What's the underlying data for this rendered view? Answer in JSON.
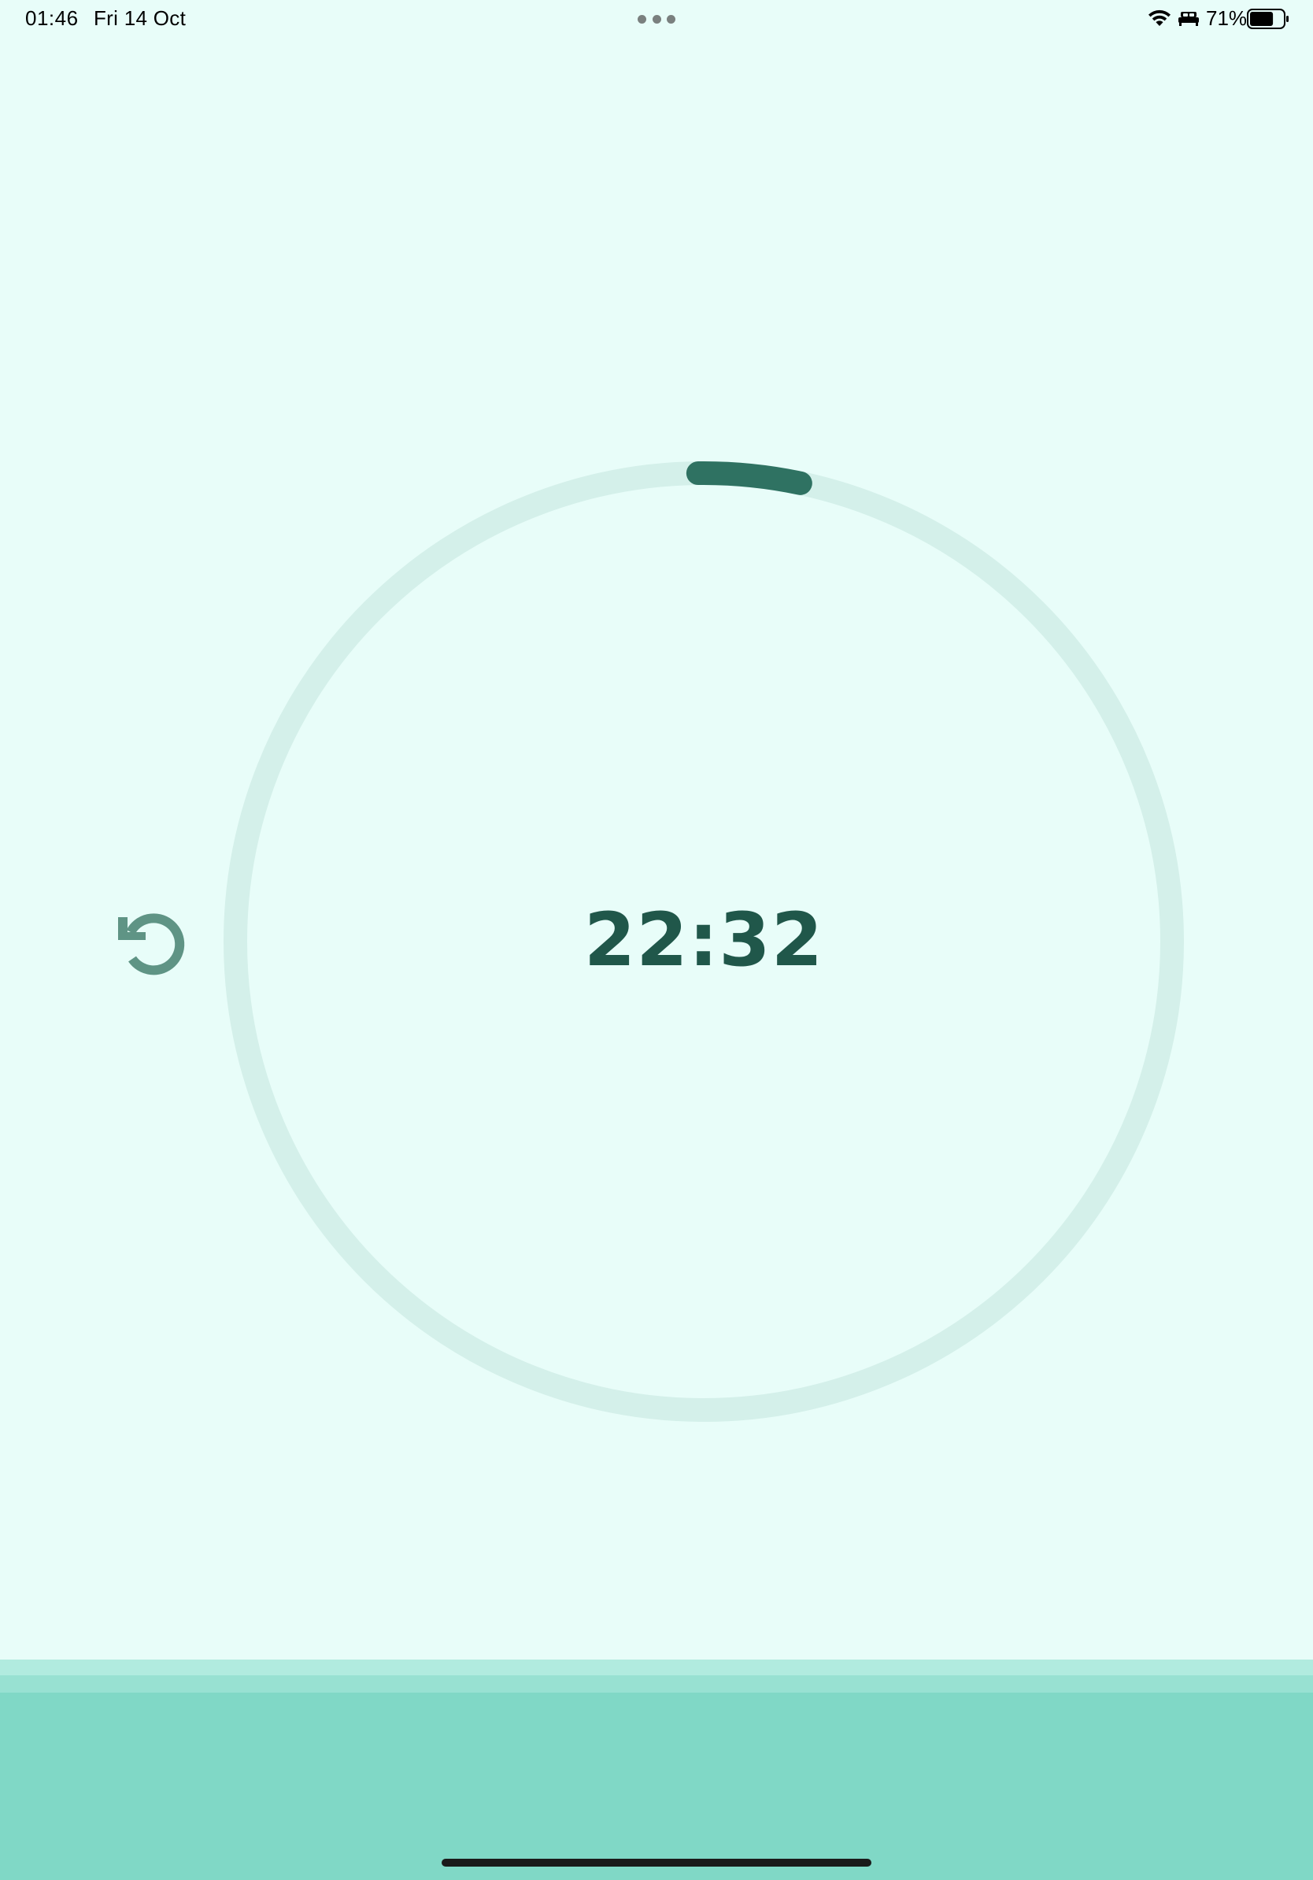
{
  "status_bar": {
    "time": "01:46",
    "date": "Fri 14 Oct",
    "battery_percent": "71%",
    "battery_level": 0.71,
    "icons": [
      "wifi-icon",
      "sleep-focus-icon",
      "battery-icon"
    ]
  },
  "timer": {
    "display": "22:32",
    "progress_fraction": 0.035,
    "reset_icon": "reset-icon"
  },
  "colors": {
    "background": "#e8fdf9",
    "ring_track": "#d4f0ea",
    "ring_progress": "#2f7262",
    "timer_text": "#20574a",
    "reset_icon": "#5f9485",
    "bottom_panel": "#80d8c6"
  }
}
